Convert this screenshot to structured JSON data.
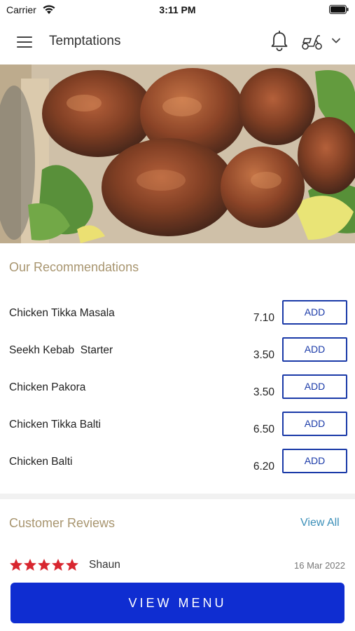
{
  "status_bar": {
    "carrier": "Carrier",
    "time": "3:11 PM"
  },
  "header": {
    "title": "Temptations"
  },
  "recommendations": {
    "title": "Our Recommendations",
    "add_label": "ADD",
    "items": [
      {
        "name": "Chicken Tikka Masala",
        "price": "7.10"
      },
      {
        "name": "Seekh Kebab  Starter",
        "price": "3.50"
      },
      {
        "name": "Chicken Pakora",
        "price": "3.50"
      },
      {
        "name": "Chicken Tikka Balti",
        "price": "6.50"
      },
      {
        "name": "Chicken Balti",
        "price": "6.20"
      }
    ]
  },
  "reviews": {
    "title": "Customer Reviews",
    "view_all": "View All",
    "items": [
      {
        "rating": 5,
        "name": "Shaun",
        "date": "16 Mar 2022"
      }
    ]
  },
  "cta": {
    "label": "VIEW MENU"
  },
  "colors": {
    "accent_gold": "#a8956f",
    "button_blue": "#0f2dd1",
    "add_border": "#1a3aa8",
    "star_red": "#d8262f",
    "link_blue": "#3b8fb8"
  }
}
